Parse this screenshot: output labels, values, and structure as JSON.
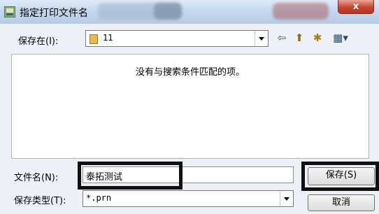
{
  "window": {
    "title": "指定打印文件名",
    "close_glyph": "x"
  },
  "save_in": {
    "label": "保存在(I):",
    "value": "11"
  },
  "toolbar": {
    "back_glyph": "⇦",
    "up_glyph": "⬆",
    "new_folder_glyph": "✱",
    "view_glyph": "▦▾"
  },
  "file_list": {
    "empty_message": "没有与搜索条件匹配的项。"
  },
  "file_name": {
    "label": "文件名(N):",
    "value": "泰拓测试"
  },
  "file_type": {
    "label": "保存类型(T):",
    "value": "*.prn"
  },
  "buttons": {
    "save": "保存(S)",
    "cancel": "取消"
  },
  "colors": {
    "highlight": "#111111",
    "close_red": "#c8442c",
    "folder_yellow": "#e8b84a"
  }
}
